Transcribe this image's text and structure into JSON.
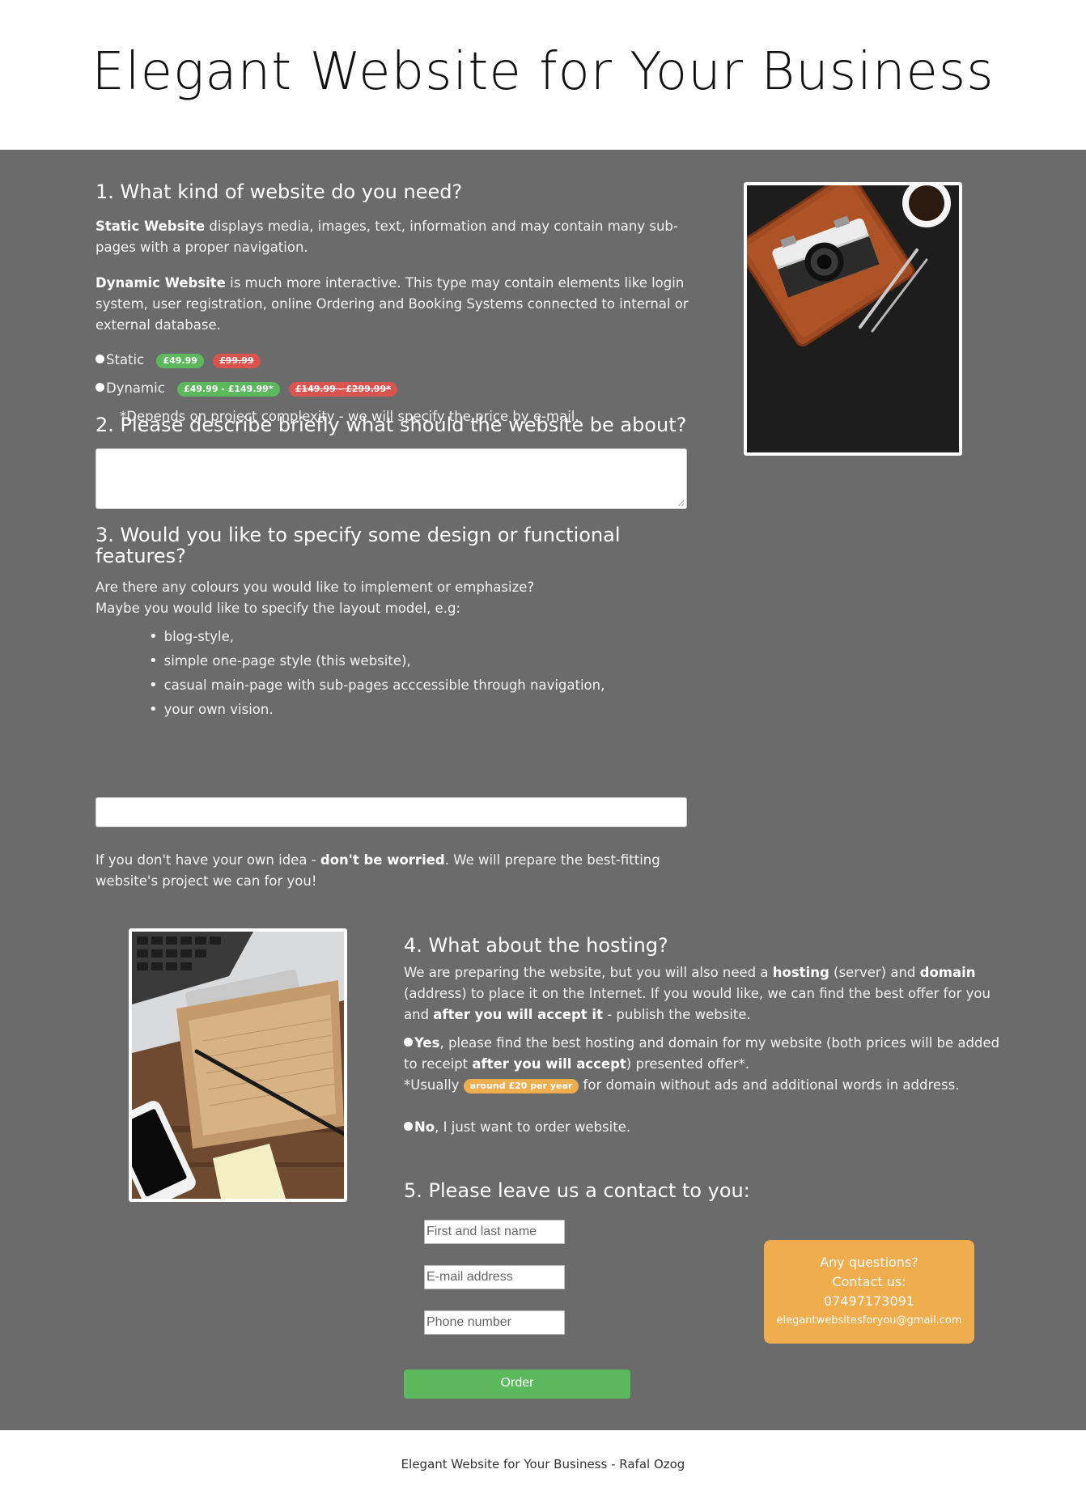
{
  "header": {
    "title": "Elegant Website for Your Business"
  },
  "section1": {
    "heading": "1. What kind of website do you need?",
    "static_desc_bold": "Static Website",
    "static_desc_rest": " displays media, images, text, information and may contain many sub-pages with a proper navigation.",
    "dynamic_desc_bold": "Dynamic Website",
    "dynamic_desc_rest": " is much more interactive. This type may contain elements like login system, user registration, online Ordering and Booking Systems connected to internal or external database.",
    "options": [
      {
        "label": "Static",
        "price": "£49.99",
        "old_price": "£99.99"
      },
      {
        "label": "Dynamic",
        "price": "£49.99 - £149.99*",
        "old_price": "£149.99 - £299.99*"
      }
    ],
    "note": "*Depends on project complexity - we will specify the price by e-mail."
  },
  "section2": {
    "heading": "2. Please describe briefly what should the website be about?"
  },
  "section3": {
    "heading": "3. Would you like to specify some design or functional features?",
    "intro_line1": "Are there any colours you would like to implement or emphasize?",
    "intro_line2": "Maybe you would like to specify the layout model, e.g:",
    "layouts": [
      "blog-style,",
      "simple one-page style (this website),",
      "casual main-page with sub-pages acccessible through navigation,",
      "your own vision."
    ],
    "outro_start": "If you don't have your own idea - ",
    "outro_bold": "don't be worried",
    "outro_end": ". We will prepare the best-fitting website's project we can for you!"
  },
  "section4": {
    "heading": "4. What about the hosting?",
    "p1_a": "We are preparing the website, but you will also need a ",
    "p1_b": "hosting",
    "p1_c": " (server) and ",
    "p1_d": "domain",
    "p1_e": " (address) to place it on the Internet. If you would like, we can find the best offer for you and ",
    "p1_f": "after you will accept it",
    "p1_g": " - publish the website.",
    "yes_bold": "Yes",
    "yes_a": ", please find the best hosting and domain for my website (both prices will be added to receipt ",
    "yes_b": "after you will accept",
    "yes_c": ") presented offer*.",
    "usually_a": "*Usually ",
    "usually_badge": "around £20 per year",
    "usually_b": " for domain without ads and additional words in address.",
    "no_bold": "No",
    "no_rest": ", I just want to order website."
  },
  "section5": {
    "heading": "5. Please leave us a contact to you:",
    "name_placeholder": "First and last name",
    "email_placeholder": "E-mail address",
    "phone_placeholder": "Phone number",
    "order_label": "Order"
  },
  "contact_box": {
    "line1": "Any questions?",
    "line2": "Contact us:",
    "phone": "07497173091",
    "email": "elegantwebsitesforyou@gmail.com"
  },
  "footer": {
    "text": "Elegant Website for Your Business - Rafal Ozog"
  },
  "colors": {
    "main_bg": "#6b6b6b",
    "accent_green": "#5cb85c",
    "accent_red": "#d9534f",
    "accent_orange": "#f0ad4e"
  },
  "images": [
    {
      "name": "camera-notebook-photo",
      "description": "camera, notebook, pens and coffee on dark desk"
    },
    {
      "name": "laptop-notepad-photo",
      "description": "laptop keyboard, notepad, pencil and phone on wooden desk"
    }
  ]
}
